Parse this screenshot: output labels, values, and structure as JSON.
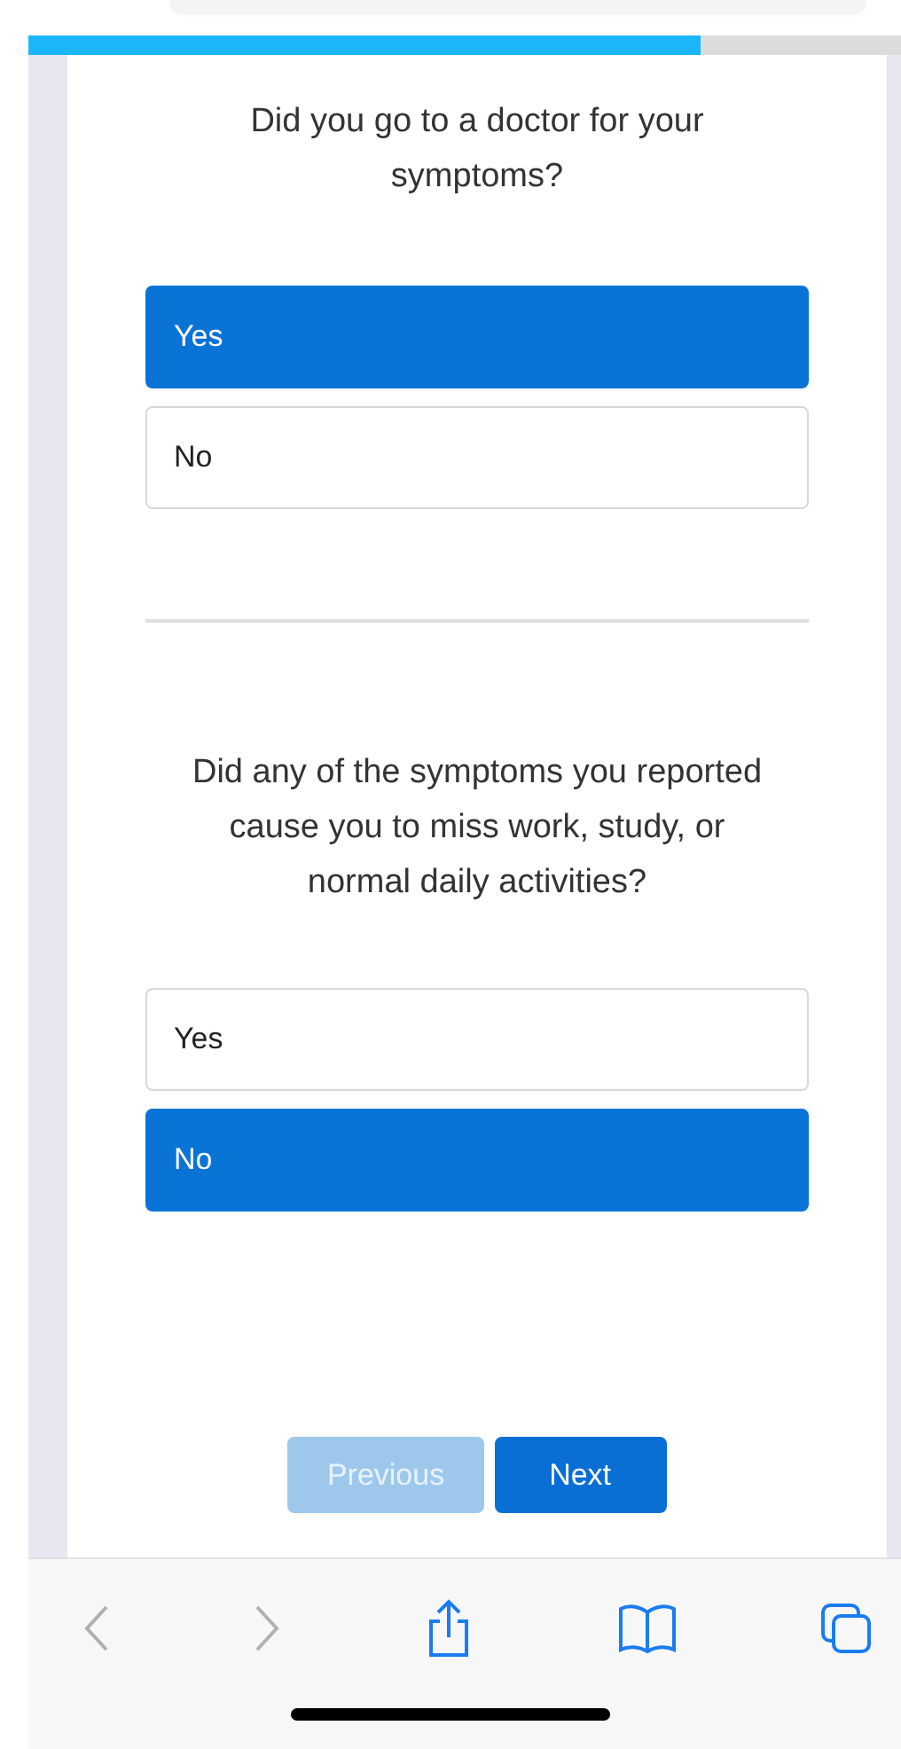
{
  "progress": {
    "level": 0.77
  },
  "questions": [
    {
      "text": "Did you go to a doctor for your symptoms?",
      "options": [
        {
          "label": "Yes",
          "selected": true
        },
        {
          "label": "No",
          "selected": false
        }
      ]
    },
    {
      "text": "Did any of the symptoms you reported cause you to miss work, study, or normal daily activities?",
      "options": [
        {
          "label": "Yes",
          "selected": false
        },
        {
          "label": "No",
          "selected": true
        }
      ]
    }
  ],
  "buttons": [
    {
      "label": "Previous",
      "disabled": true
    },
    {
      "label": "Next",
      "disabled": false
    }
  ],
  "toolbar": {
    "back_disabled": true,
    "forward_disabled": true
  }
}
